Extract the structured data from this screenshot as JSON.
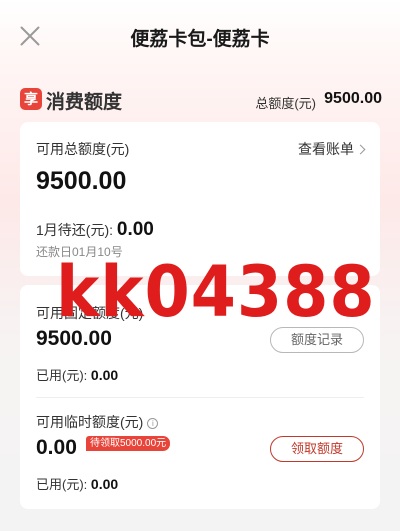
{
  "header": {
    "title": "便荔卡包-便荔卡"
  },
  "section": {
    "icon_glyph": "享",
    "title": "消费额度",
    "total_label": "总额度(元)",
    "total_value": "9500.00"
  },
  "card1": {
    "available_label": "可用总额度(元)",
    "available_value": "9500.00",
    "bill_link": "查看账单",
    "due_label": "1月待还(元):",
    "due_value": "0.00",
    "repay_date": "还款日01月10号"
  },
  "card2": {
    "fixed": {
      "label": "可用固定额度(元)",
      "value": "9500.00",
      "button": "额度记录",
      "used_label": "已用(元):",
      "used_value": "0.00"
    },
    "temp": {
      "label": "可用临时额度(元)",
      "info_glyph": "i",
      "value": "0.00",
      "pending_badge": "待领取5000.00元",
      "button": "领取额度",
      "used_label": "已用(元):",
      "used_value": "0.00"
    }
  },
  "watermark": {
    "text": "kk04388"
  },
  "colors": {
    "accent": "#e8443a",
    "watermark": "#e01d1d"
  }
}
